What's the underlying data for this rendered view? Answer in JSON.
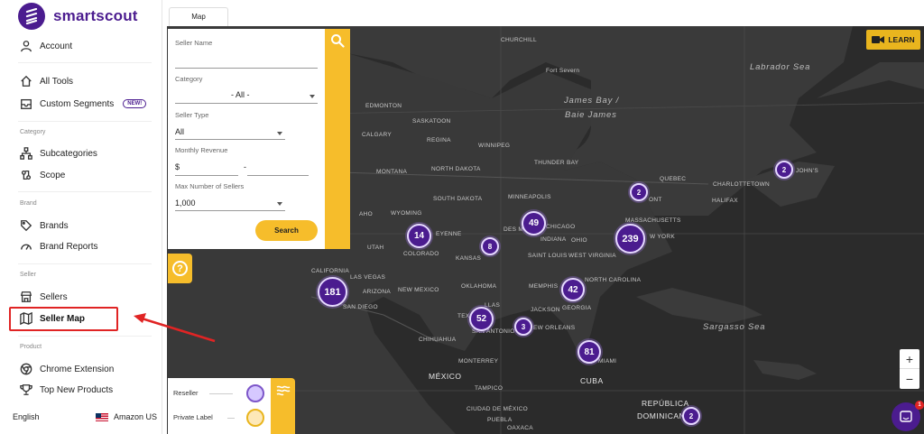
{
  "brand": {
    "name": "smartscout"
  },
  "sidebar": {
    "account": "Account",
    "all_tools": "All Tools",
    "custom_segments": "Custom Segments",
    "new_badge": "NEW!",
    "section_category": "Category",
    "subcategories": "Subcategories",
    "scope": "Scope",
    "section_brand": "Brand",
    "brands": "Brands",
    "brand_reports": "Brand Reports",
    "section_seller": "Seller",
    "sellers": "Sellers",
    "seller_map": "Seller Map",
    "section_product": "Product",
    "chrome_extension": "Chrome Extension",
    "top_new_products": "Top New Products",
    "language": "English",
    "marketplace": "Amazon US"
  },
  "map": {
    "tab": "Map",
    "learn_label": "LEARN",
    "labels": {
      "churchill": "CHURCHILL",
      "fort_severn": "Fort Severn",
      "labrador_sea": "Labrador Sea",
      "james_bay_1": "James Bay /",
      "james_bay_2": "Baie James",
      "edmonton": "EDMONTON",
      "saskatoon": "SASKATOON",
      "calgary": "CALGARY",
      "regina": "REGINA",
      "winnipeg": "WINNIPEG",
      "thunder_bay": "THUNDER BAY",
      "quebec": "QUEBEC",
      "st_johns": "JOHN'S",
      "montana": "MONTANA",
      "north_dakota": "NORTH DAKOTA",
      "charlottetown": "CHARLOTTETOWN",
      "halifax": "HALIFAX",
      "south_dakota": "SOUTH DAKOTA",
      "minneapolis": "MINNEAPOLIS",
      "ont": "ONT",
      "wyoming": "WYOMING",
      "massachusetts": "MASSACHUSETTS",
      "chicago": "CHICAGO",
      "des_m": "DES M",
      "ohio": "OHIO",
      "new_york": "W YORK",
      "eyenne": "EYENNE",
      "utah": "UTAH",
      "indiana": "INDIANA",
      "colorado": "COLORADO",
      "kansas": "KANSAS",
      "saint_louis": "SAINT LOUIS",
      "west_virginia": "WEST VIRGINIA",
      "california": "CALIFORNIA",
      "las_vegas": "LAS VEGAS",
      "arizona": "ARIZONA",
      "oklahoma": "OKLAHOMA",
      "memphis": "MEMPHIS",
      "north_carolina": "NORTH CAROLINA",
      "new_mexico": "NEW MEXICO",
      "san_diego": "SAN DIEGO",
      "llas": "LLAS",
      "jackson": "JACKSON",
      "georgia": "GEORGIA",
      "tex": "TEX",
      "san_antonio": "SAN ANTONIO",
      "new_orleans": "EW ORLEANS",
      "chihuahua": "CHIHUAHUA",
      "sargasso_sea": "Sargasso Sea",
      "monterrey": "MONTERREY",
      "miami": "MIAMI",
      "mexico": "MÉXICO",
      "cuba": "CUBA",
      "tampico": "TAMPICO",
      "republica_1": "REPÚBLICA",
      "republica_2": "DOMINICAN",
      "ciudad_de_mexico": "CIUDAD DE MÉXICO",
      "puebla": "PUEBLA",
      "oaxaca": "OAXACA",
      "aho": "AHO"
    },
    "clusters": {
      "c14": "14",
      "c8": "8",
      "c49": "49",
      "c239": "239",
      "c2_ont": "2",
      "c2_nf": "2",
      "c181": "181",
      "c42": "42",
      "c52": "52",
      "c3": "3",
      "c81": "81",
      "c2_dr": "2"
    }
  },
  "filters": {
    "seller_name_label": "Seller Name",
    "seller_name_value": "",
    "category_label": "Category",
    "category_value": "- All -",
    "seller_type_label": "Seller Type",
    "seller_type_value": "All",
    "monthly_revenue_label": "Monthly Revenue",
    "revenue_prefix": "$",
    "revenue_sep": "-",
    "max_sellers_label": "Max Number of Sellers",
    "max_sellers_value": "1,000",
    "search_button": "Search"
  },
  "legend": {
    "reseller": "Reseller",
    "private_label": "Private Label"
  },
  "zoom": {
    "in": "+",
    "out": "−"
  },
  "chat": {
    "badge": "1"
  },
  "colors": {
    "brand_purple": "#4b1c8f",
    "accent_yellow": "#f6bd2b",
    "map_bg": "#2e2e2e",
    "highlight_red": "#e02424"
  }
}
